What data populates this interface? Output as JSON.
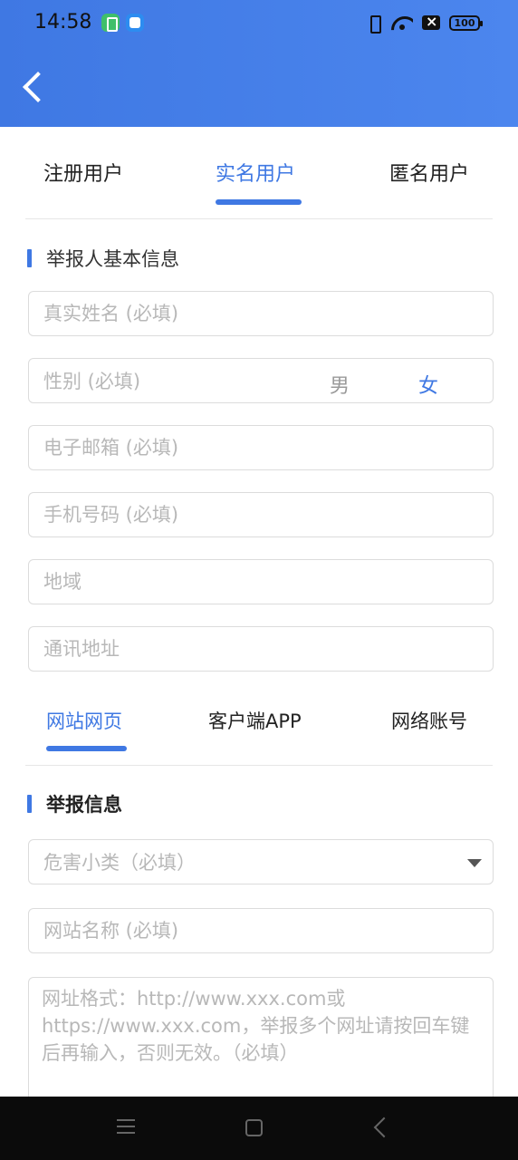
{
  "status_bar": {
    "time": "14:58",
    "battery": "100"
  },
  "user_tabs": [
    "注册用户",
    "实名用户",
    "匿名用户"
  ],
  "section_basic": "举报人基本信息",
  "fields": {
    "name_placeholder": "真实姓名 (必填)",
    "gender_label": "性别 (必填)",
    "gender_male": "男",
    "gender_female": "女",
    "email_placeholder": "电子邮箱 (必填)",
    "phone_placeholder": "手机号码 (必填)",
    "region_placeholder": "地域",
    "address_placeholder": "通讯地址"
  },
  "target_tabs": [
    "网站网页",
    "客户端APP",
    "网络账号"
  ],
  "section_report": "举报信息",
  "report": {
    "category_placeholder": "危害小类（必填）",
    "site_name_placeholder": "网站名称 (必填)",
    "url_placeholder": "网址格式：http://www.xxx.com或https://www.xxx.com，举报多个网址请按回车键后再输入，否则无效。（必填）"
  },
  "colors": {
    "accent": "#3f78e3",
    "header": "#4c86ee"
  }
}
